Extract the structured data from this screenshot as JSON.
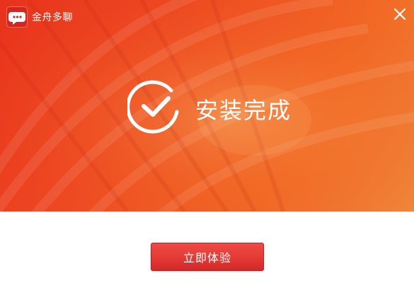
{
  "app": {
    "title": "金舟多聊",
    "logo_icon": "chat-bubble-icon"
  },
  "window": {
    "close_icon": "close-icon"
  },
  "status": {
    "text": "安装完成",
    "icon": "check-circle-icon"
  },
  "actions": {
    "primary_label": "立即体验"
  },
  "colors": {
    "banner_start": "#e8321c",
    "banner_end": "#f08a3c",
    "button": "#e33a35",
    "button_border": "#c3201b",
    "logo_bg": "#d5261d",
    "text_light": "#ffffff"
  }
}
